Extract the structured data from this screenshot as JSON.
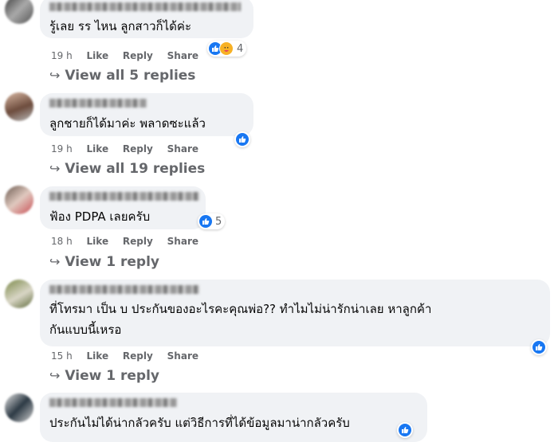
{
  "comments": [
    {
      "text": [
        "รู้เลย รร ไหน ลูกสาวก็ได้ค่ะ"
      ],
      "time": "19 h",
      "reaction_count": "4",
      "replies": "View all 5 replies"
    },
    {
      "text": [
        "ลูกชายก็ได้มาค่ะ พลาดซะแล้ว"
      ],
      "time": "19 h",
      "reaction_count": "",
      "replies": "View all 19 replies"
    },
    {
      "text": [
        "ฟ้อง PDPA เลยครับ"
      ],
      "time": "18 h",
      "reaction_count": "5",
      "replies": "View 1 reply"
    },
    {
      "text": [
        "ที่โทรมา เป็น บ ประกันของอะไรคะคุณพ่อ?? ทำไมไม่น่ารักน่าเลย หาลูกค้า",
        "กันแบบนี้เหรอ"
      ],
      "time": "15 h",
      "reaction_count": "",
      "replies": "View 1 reply"
    },
    {
      "text": [
        "ประกันไม่ได้น่ากลัวครับ แต่วิธีการที่ได้ข้อมูลมาน่ากลัวครับ"
      ],
      "time": "",
      "reaction_count": "",
      "replies": ""
    }
  ],
  "actions": {
    "like": "Like",
    "reply": "Reply",
    "share": "Share"
  },
  "icons": {
    "reply_arrow": "reply-arrow-icon",
    "like": "like-reaction-icon",
    "care": "care-reaction-icon"
  },
  "colors": {
    "bubble": "#f0f2f5",
    "meta_text": "#65676b",
    "like_blue": "#1877f2",
    "text": "#050505"
  }
}
